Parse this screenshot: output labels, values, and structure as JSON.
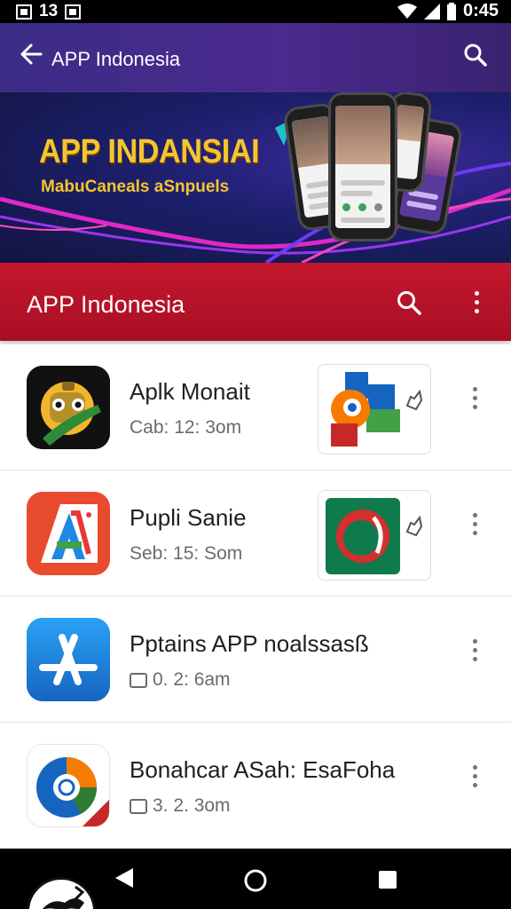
{
  "status_bar": {
    "left_text": "13",
    "time": "0:45",
    "icons": [
      "notification-icon",
      "wifi-icon",
      "signal-icon",
      "battery-icon"
    ]
  },
  "top_bar": {
    "title": "APP Indonesia",
    "back_icon": "arrow-left-icon",
    "search_icon": "search-icon"
  },
  "banner": {
    "headline": "APP INDANSIAI",
    "subline": "MabuCaneals aSnpuels"
  },
  "red_bar": {
    "title": "APP Indonesia",
    "search_icon": "search-icon",
    "more_icon": "more-vert-icon"
  },
  "list": {
    "items": [
      {
        "name": "Aplk Monait",
        "meta": "Cab: 12: 3om",
        "has_thumb": true
      },
      {
        "name": "Pupli Sanie",
        "meta": "Seb: 15: Som",
        "has_thumb": true
      },
      {
        "name": "Pptains APP noalssasß",
        "meta": "0. 2: 6am",
        "has_thumb": false
      },
      {
        "name": "Bonahcar ASah: EsaFoha",
        "meta": "3. 2. 3om",
        "has_thumb": false
      }
    ]
  },
  "colors": {
    "top_bar": "#3b2c86",
    "red_bar": "#c4172d",
    "banner_text": "#f4c531"
  },
  "nav_bar": {
    "back_icon": "nav-back-icon",
    "home_icon": "nav-home-icon",
    "recents_icon": "nav-recents-icon"
  }
}
